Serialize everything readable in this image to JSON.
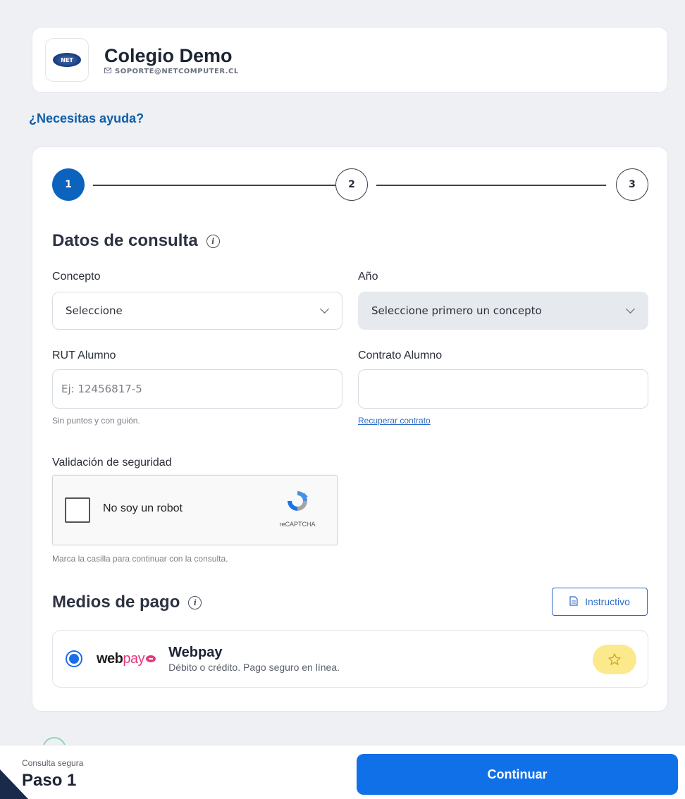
{
  "header": {
    "school_name": "Colegio Demo",
    "email": "SOPORTE@NETCOMPUTER.CL",
    "logo_text": "NET"
  },
  "help_link": "¿Necesitas ayuda?",
  "stepper": {
    "steps": [
      "1",
      "2",
      "3"
    ],
    "active_step": 1
  },
  "consulta": {
    "title": "Datos de consulta",
    "concepto": {
      "label": "Concepto",
      "value": "Seleccione"
    },
    "anio": {
      "label": "Año",
      "value": "Seleccione primero un concepto"
    },
    "rut": {
      "label": "RUT Alumno",
      "placeholder": "Ej: 12456817-5",
      "hint": "Sin puntos y con guión."
    },
    "contrato": {
      "label": "Contrato Alumno",
      "value": "",
      "link": "Recuperar contrato"
    },
    "security": {
      "label": "Validación de seguridad",
      "captcha_text": "No soy un robot",
      "captcha_brand": "reCAPTCHA",
      "hint": "Marca la casilla para continuar con la consulta."
    }
  },
  "payment": {
    "title": "Medios de pago",
    "instructivo_label": "Instructivo",
    "methods": [
      {
        "logo_part1": "web",
        "logo_part2": "pay",
        "name": "Webpay",
        "description": "Débito o crédito. Pago seguro en línea.",
        "selected": true
      }
    ]
  },
  "footer": {
    "subtitle": "Consulta segura",
    "step_label": "Paso 1",
    "continue_label": "Continuar"
  },
  "colors": {
    "primary": "#1070e8",
    "step_active": "#0b63be",
    "link": "#0d5ea8",
    "star_badge": "#fbe98c"
  }
}
